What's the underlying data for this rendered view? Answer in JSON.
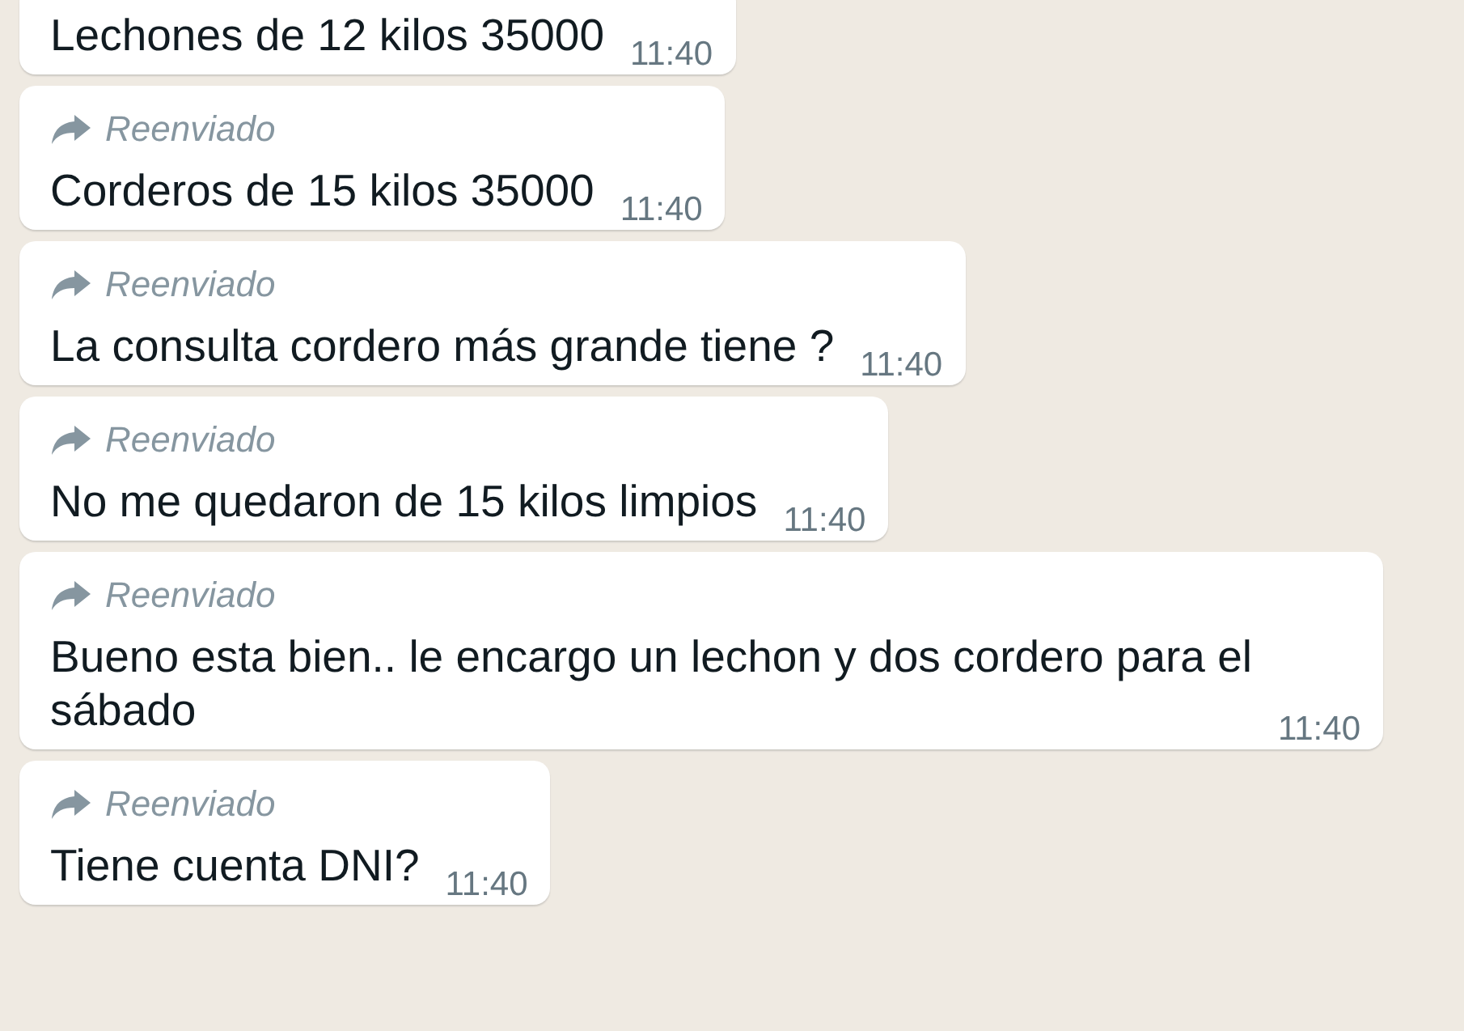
{
  "messages": [
    {
      "forwarded": false,
      "lines": [
        "Lechones de 12 kilos 35000"
      ],
      "time": "11:40"
    },
    {
      "forwarded": true,
      "forwarded_label": "Reenviado",
      "lines": [
        "Corderos de 15 kilos 35000"
      ],
      "time": "11:40"
    },
    {
      "forwarded": true,
      "forwarded_label": "Reenviado",
      "lines": [
        "La consulta cordero más grande tiene ?"
      ],
      "time": "11:40"
    },
    {
      "forwarded": true,
      "forwarded_label": "Reenviado",
      "lines": [
        "No me quedaron de 15 kilos limpios"
      ],
      "time": "11:40"
    },
    {
      "forwarded": true,
      "forwarded_label": "Reenviado",
      "lines": [
        "Bueno esta bien.. le encargo un lechon y dos cordero para el",
        "sábado"
      ],
      "time": "11:40"
    },
    {
      "forwarded": true,
      "forwarded_label": "Reenviado",
      "lines": [
        "Tiene cuenta DNI?"
      ],
      "time": "11:40"
    }
  ]
}
